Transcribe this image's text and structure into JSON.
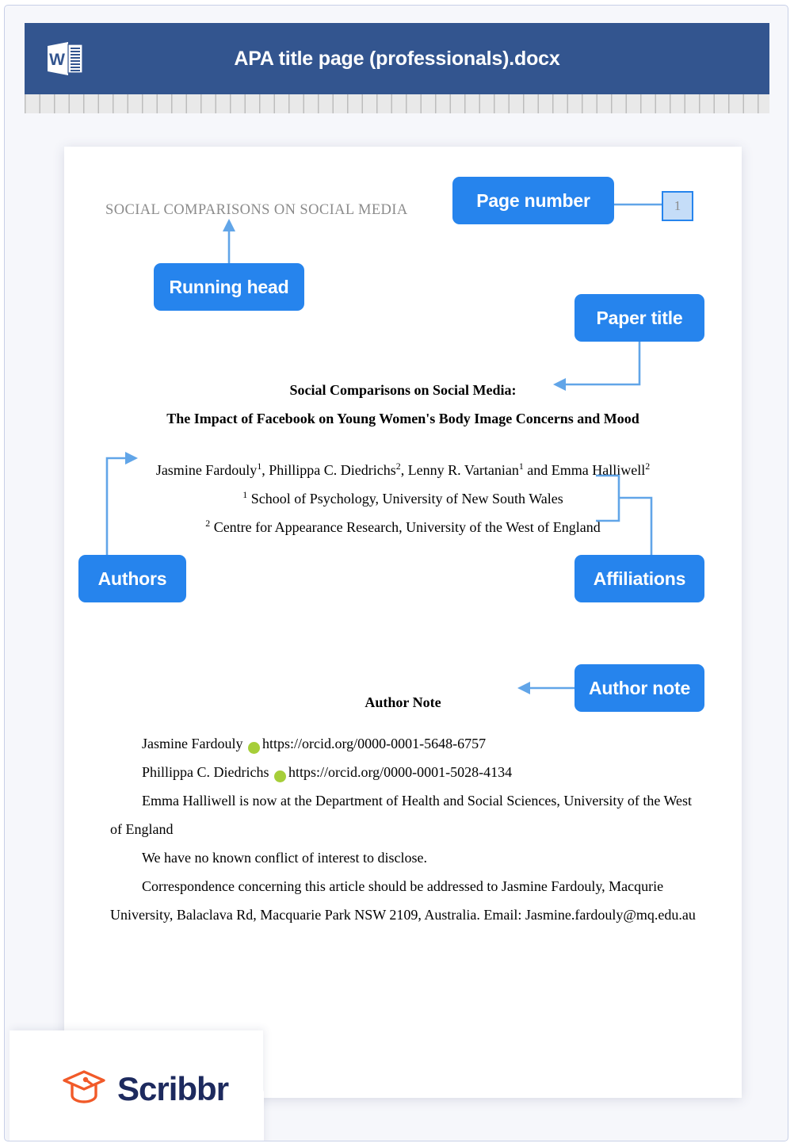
{
  "window": {
    "title": "APA title page (professionals).docx",
    "app_icon": "word-document-icon",
    "header_color": "#33558f"
  },
  "annotations": {
    "accent_color": "#2684ed",
    "connector_color": "#61a5e8",
    "badges": [
      {
        "id": "running-head",
        "label": "Running head"
      },
      {
        "id": "page-number",
        "label": "Page number"
      },
      {
        "id": "paper-title",
        "label": "Paper title"
      },
      {
        "id": "authors",
        "label": "Authors"
      },
      {
        "id": "affiliations",
        "label": "Affiliations"
      },
      {
        "id": "author-note",
        "label": "Author note"
      }
    ]
  },
  "document": {
    "running_head": "SOCIAL COMPARISONS ON SOCIAL MEDIA",
    "page_number": "1",
    "title_line_1": "Social Comparisons on Social Media:",
    "title_line_2": "The Impact of Facebook on Young Women's Body Image Concerns and Mood",
    "authors": {
      "prefix": "",
      "items": [
        {
          "name": "Jasmine Fardouly",
          "sup": "1",
          "sep": ", "
        },
        {
          "name": "Phillippa C. Diedrichs",
          "sup": "2",
          "sep": ", "
        },
        {
          "name": "Lenny R. Vartanian",
          "sup": "1",
          "sep": " and "
        },
        {
          "name": "Emma Halliwell",
          "sup": "2",
          "sep": ""
        }
      ]
    },
    "affiliations": [
      {
        "sup": "1",
        "text": "School of Psychology, University of New South Wales"
      },
      {
        "sup": "2",
        "text": "Centre for Appearance Research, University of the West of England"
      }
    ],
    "author_note": {
      "heading": "Author Note",
      "orcid_icon_color": "#a6ce39",
      "orcid_icon_label": "iD",
      "orcid_entries": [
        {
          "name": "Jasmine Fardouly",
          "url": "https://orcid.org/0000-0001-5648-6757"
        },
        {
          "name": "Phillippa C. Diedrichs",
          "url": "https://orcid.org/0000-0001-5028-4134"
        }
      ],
      "paragraphs": [
        "Emma Halliwell is now at the Department of Health and Social Sciences, University of the West of England",
        "We have no known conflict of interest to disclose.",
        "Correspondence concerning this article should be addressed to Jasmine Fardouly, Macqurie University, Balaclava Rd, Macquarie Park NSW 2109, Australia. Email: Jasmine.fardouly@mq.edu.au"
      ]
    }
  },
  "branding": {
    "logo_text": "Scribbr",
    "logo_icon": "graduation-cap-icon",
    "logo_icon_color": "#f15a29",
    "logo_text_color": "#1d2a5e"
  }
}
